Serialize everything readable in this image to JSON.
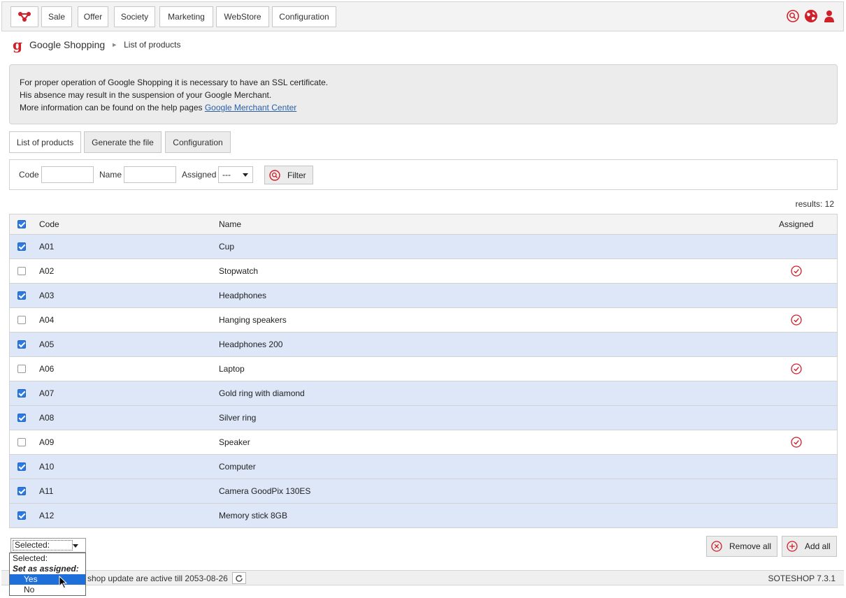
{
  "topbar": {
    "logo_icon": "soteshop-logo-icon",
    "nav": [
      "Sale",
      "Offer",
      "Society",
      "Marketing",
      "WebStore",
      "Configuration"
    ],
    "icons": [
      "search-icon",
      "globe-icon",
      "user-icon"
    ],
    "accent": "#d0202a"
  },
  "breadcrumb": {
    "logo": "g",
    "main": "Google Shopping",
    "sep": "►",
    "sub": "List of products"
  },
  "notice": {
    "line1": "For proper operation of Google Shopping it is necessary to have an SSL certificate.",
    "line2": "His absence may result in the suspension of your Google Merchant.",
    "line3_prefix": "More information can be found on the help pages ",
    "link": "Google Merchant Center"
  },
  "tabs": [
    {
      "label": "List of products",
      "active": true
    },
    {
      "label": "Generate the file",
      "active": false
    },
    {
      "label": "Configuration",
      "active": false
    }
  ],
  "filter": {
    "code_label": "Code",
    "code_value": "",
    "name_label": "Name",
    "name_value": "",
    "assigned_label": "Assigned",
    "assigned_value": "---",
    "button": "Filter"
  },
  "results": "results: 12",
  "table": {
    "headers": {
      "code": "Code",
      "name": "Name",
      "assigned": "Assigned"
    },
    "header_checked": true,
    "rows": [
      {
        "code": "A01",
        "name": "Cup",
        "checked": true,
        "assigned": false
      },
      {
        "code": "A02",
        "name": "Stopwatch",
        "checked": false,
        "assigned": true
      },
      {
        "code": "A03",
        "name": "Headphones",
        "checked": true,
        "assigned": false
      },
      {
        "code": "A04",
        "name": "Hanging speakers",
        "checked": false,
        "assigned": true
      },
      {
        "code": "A05",
        "name": "Headphones 200",
        "checked": true,
        "assigned": false
      },
      {
        "code": "A06",
        "name": "Laptop",
        "checked": false,
        "assigned": true
      },
      {
        "code": "A07",
        "name": "Gold ring with diamond",
        "checked": true,
        "assigned": false
      },
      {
        "code": "A08",
        "name": "Silver ring",
        "checked": true,
        "assigned": false
      },
      {
        "code": "A09",
        "name": "Speaker",
        "checked": false,
        "assigned": true
      },
      {
        "code": "A10",
        "name": "Computer",
        "checked": true,
        "assigned": false
      },
      {
        "code": "A11",
        "name": "Camera GoodPix 130ES",
        "checked": true,
        "assigned": false
      },
      {
        "code": "A12",
        "name": "Memory stick 8GB",
        "checked": true,
        "assigned": false
      }
    ]
  },
  "bulk": {
    "selected": "Selected:",
    "options": [
      "Selected:"
    ],
    "group": "Set as assigned:",
    "group_options": [
      "Yes",
      "No"
    ],
    "highlighted": "Yes"
  },
  "actions": {
    "remove_all": "Remove all",
    "add_all": "Add all"
  },
  "footer": {
    "text": "shop update are active till 2053-08-26",
    "version": "SOTESHOP 7.3.1"
  }
}
